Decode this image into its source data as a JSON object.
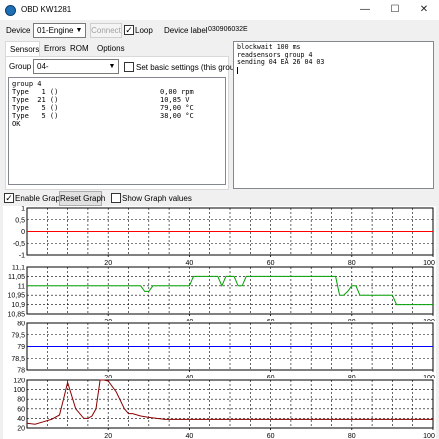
{
  "window": {
    "title": "OBD KW1281",
    "minimize": "—",
    "maximize": "☐",
    "close": "✕"
  },
  "toolbar": {
    "device_label": "Device",
    "device_value": "01-Engine",
    "connect_label": "Connect",
    "loop_label": "Loop",
    "loop_checked": true,
    "device_label_caption": "Device label",
    "device_label_value": "030906032E"
  },
  "tabs": [
    "Sensors",
    "Errors",
    "ROM",
    "Options"
  ],
  "sensors": {
    "group_label": "Group",
    "group_value": "04-",
    "basic_settings_label": "Set basic settings (this group",
    "header": "group 4",
    "rows": [
      {
        "name": "Type   1 ()",
        "value": "0,00 rpm"
      },
      {
        "name": "Type  21 ()",
        "value": "10,85 V"
      },
      {
        "name": "Type   5 ()",
        "value": "79,00 °C"
      },
      {
        "name": "Type   5 ()",
        "value": "38,00 °C"
      }
    ],
    "status": "OK"
  },
  "log": {
    "lines": [
      "blockwait 100 ms",
      "readsensors group 4",
      "sending 04 EA 26 04 03"
    ]
  },
  "graph_controls": {
    "enable_label": "Enable Graph",
    "enable_checked": true,
    "reset_label": "Reset Graph",
    "show_values_label": "Show Graph values",
    "show_values_checked": false
  },
  "chart_data": [
    {
      "type": "line",
      "xlim": [
        0,
        100
      ],
      "ylim": [
        -1,
        1
      ],
      "x_ticks": [
        20,
        40,
        60,
        80,
        100
      ],
      "y_ticks": [
        "1",
        "0,5",
        "0",
        "-0,5",
        "-1"
      ],
      "grid": true,
      "color": "#ff0000",
      "series": [
        {
          "x": [
            0,
            100
          ],
          "y": [
            0,
            0
          ]
        }
      ]
    },
    {
      "type": "line",
      "xlim": [
        0,
        100
      ],
      "ylim": [
        10.85,
        11.1
      ],
      "x_ticks": [
        20,
        40,
        60,
        80,
        100
      ],
      "y_ticks": [
        "11,1",
        "11,05",
        "11",
        "10,95",
        "10,9",
        "10,85"
      ],
      "grid": true,
      "color": "#00a000",
      "series": [
        {
          "x": [
            0,
            28,
            29,
            30,
            31,
            32,
            33,
            40,
            41,
            42,
            47,
            48,
            49,
            50,
            51,
            52,
            53,
            54,
            55,
            56,
            57,
            76,
            77,
            78,
            79,
            80,
            81,
            82,
            86,
            87,
            88,
            90,
            91,
            92,
            93,
            100
          ],
          "y": [
            11.0,
            11.0,
            10.97,
            10.97,
            11.0,
            11.0,
            11.0,
            11.0,
            11.05,
            11.05,
            11.05,
            11.0,
            11.05,
            11.05,
            11.05,
            11.0,
            11.0,
            11.05,
            11.05,
            11.05,
            11.05,
            11.05,
            10.95,
            10.95,
            10.97,
            11.0,
            11.0,
            10.95,
            10.95,
            10.95,
            10.95,
            10.95,
            10.9,
            10.9,
            10.9,
            10.9
          ]
        }
      ]
    },
    {
      "type": "line",
      "xlim": [
        0,
        100
      ],
      "ylim": [
        78,
        80
      ],
      "x_ticks": [
        20,
        40,
        60,
        80,
        100
      ],
      "y_ticks": [
        "80",
        "79,5",
        "79",
        "78,5",
        "78"
      ],
      "grid": true,
      "color": "#0000ff",
      "series": [
        {
          "x": [
            0,
            100
          ],
          "y": [
            79,
            79
          ]
        }
      ]
    },
    {
      "type": "line",
      "xlim": [
        0,
        100
      ],
      "ylim": [
        20,
        120
      ],
      "x_ticks": [
        20,
        40,
        60,
        80,
        100
      ],
      "y_ticks": [
        "120",
        "100",
        "80",
        "60",
        "40",
        "20"
      ],
      "grid": true,
      "color": "#8b0000",
      "series": [
        {
          "x": [
            0,
            2,
            4,
            6,
            8,
            9,
            10,
            12,
            14,
            15,
            16,
            17,
            18,
            19,
            20,
            22,
            24,
            25,
            26,
            28,
            30,
            32,
            34,
            100
          ],
          "y": [
            30,
            28,
            33,
            38,
            47,
            80,
            115,
            60,
            40,
            40,
            45,
            60,
            120,
            120,
            118,
            95,
            60,
            50,
            50,
            45,
            42,
            40,
            38,
            38
          ]
        }
      ]
    }
  ]
}
